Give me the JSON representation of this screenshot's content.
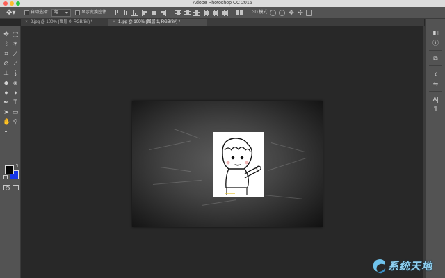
{
  "window": {
    "title": "Adobe Photoshop CC 2015"
  },
  "options_bar": {
    "auto_select_label": "自动选择:",
    "auto_select_target": "组",
    "show_transform_label": "显示变换控件",
    "mode_3d_label": "3D 模式:"
  },
  "tabs": [
    {
      "label": "2.jpg @ 100% (图层 0, RGB/8#) *",
      "active": false
    },
    {
      "label": "1.jpg @ 100% (图层 1, RGB/8#) *",
      "active": true
    }
  ],
  "colors": {
    "foreground": "#050505",
    "background": "#1536e8"
  },
  "watermark": {
    "text": "系统天地"
  }
}
